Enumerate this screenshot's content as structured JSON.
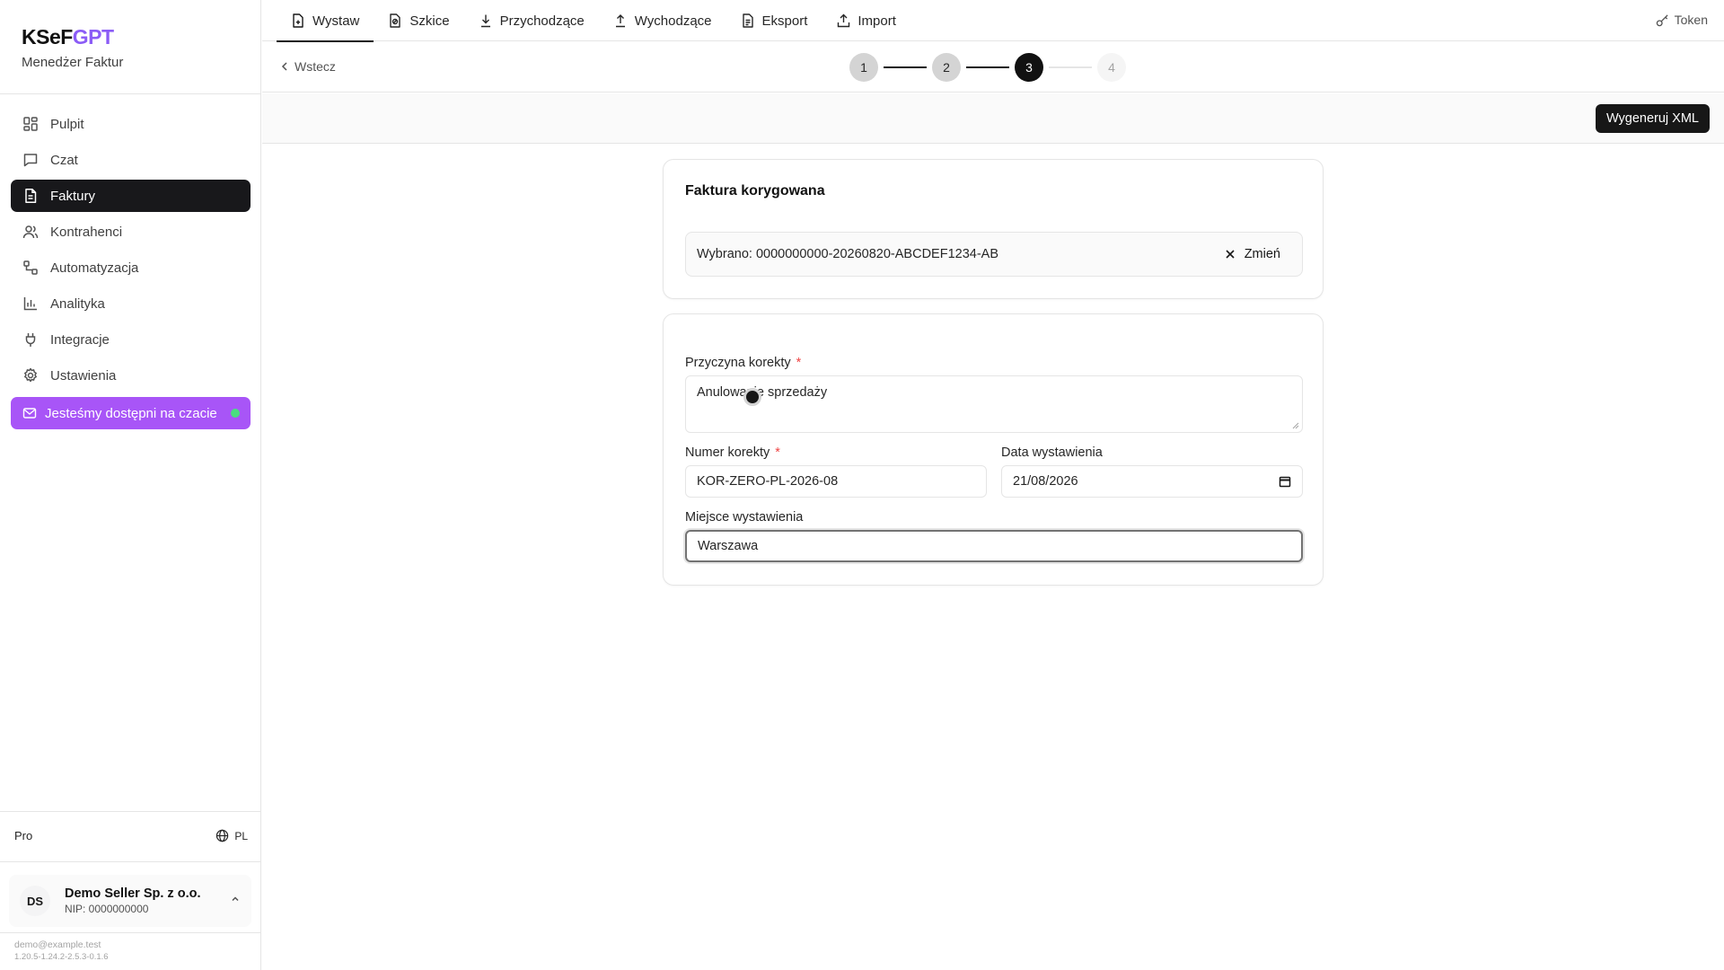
{
  "brand": {
    "name_main": "KSeF",
    "name_accent": "GPT",
    "subtitle": "Menedżer Faktur",
    "accent_color": "#8b5cf6"
  },
  "sidebar": {
    "items": [
      {
        "label": "Pulpit",
        "icon": "dashboard-icon"
      },
      {
        "label": "Czat",
        "icon": "chat-icon"
      },
      {
        "label": "Faktury",
        "icon": "invoice-icon",
        "active": true
      },
      {
        "label": "Kontrahenci",
        "icon": "users-icon"
      },
      {
        "label": "Automatyzacja",
        "icon": "workflow-icon"
      },
      {
        "label": "Analityka",
        "icon": "chart-icon"
      },
      {
        "label": "Integracje",
        "icon": "plug-icon"
      },
      {
        "label": "Ustawienia",
        "icon": "gear-icon"
      }
    ],
    "chat_cta": {
      "label": "Jesteśmy dostępni na czacie",
      "color": "#a855f7",
      "status_color": "#4ade80"
    },
    "plan": "Pro",
    "language": "PL",
    "account": {
      "initials": "DS",
      "name": "Demo Seller Sp. z o.o.",
      "nip": "NIP: 0000000000"
    },
    "footer_email": "demo@example.test",
    "footer_version": "1.20.5-1.24.2-2.5.3-0.1.6"
  },
  "tabs": [
    {
      "label": "Wystaw",
      "icon": "file-plus-icon",
      "active": true
    },
    {
      "label": "Szkice",
      "icon": "draft-icon"
    },
    {
      "label": "Przychodzące",
      "icon": "download-icon"
    },
    {
      "label": "Wychodzące",
      "icon": "upload-icon"
    },
    {
      "label": "Eksport",
      "icon": "export-icon"
    },
    {
      "label": "Import",
      "icon": "import-icon"
    }
  ],
  "token_label": "Token",
  "back_label": "Wstecz",
  "stepper": {
    "steps": [
      "1",
      "2",
      "3",
      "4"
    ],
    "current": 3
  },
  "generate_label": "Wygeneruj XML",
  "corrected_invoice": {
    "title": "Faktura korygowana",
    "selected_text": "Wybrano: 0000000000-20260820-ABCDEF1234-AB",
    "change_label": "Zmień"
  },
  "form": {
    "reason": {
      "label": "Przyczyna korekty",
      "required_mark": "*",
      "value": "Anulowanie sprzedaży"
    },
    "number": {
      "label": "Numer korekty",
      "required_mark": "*",
      "value": "KOR-ZERO-PL-2026-08"
    },
    "date": {
      "label": "Data wystawienia",
      "value": "21/08/2026"
    },
    "place": {
      "label": "Miejsce wystawienia",
      "value": "Warszawa"
    }
  }
}
